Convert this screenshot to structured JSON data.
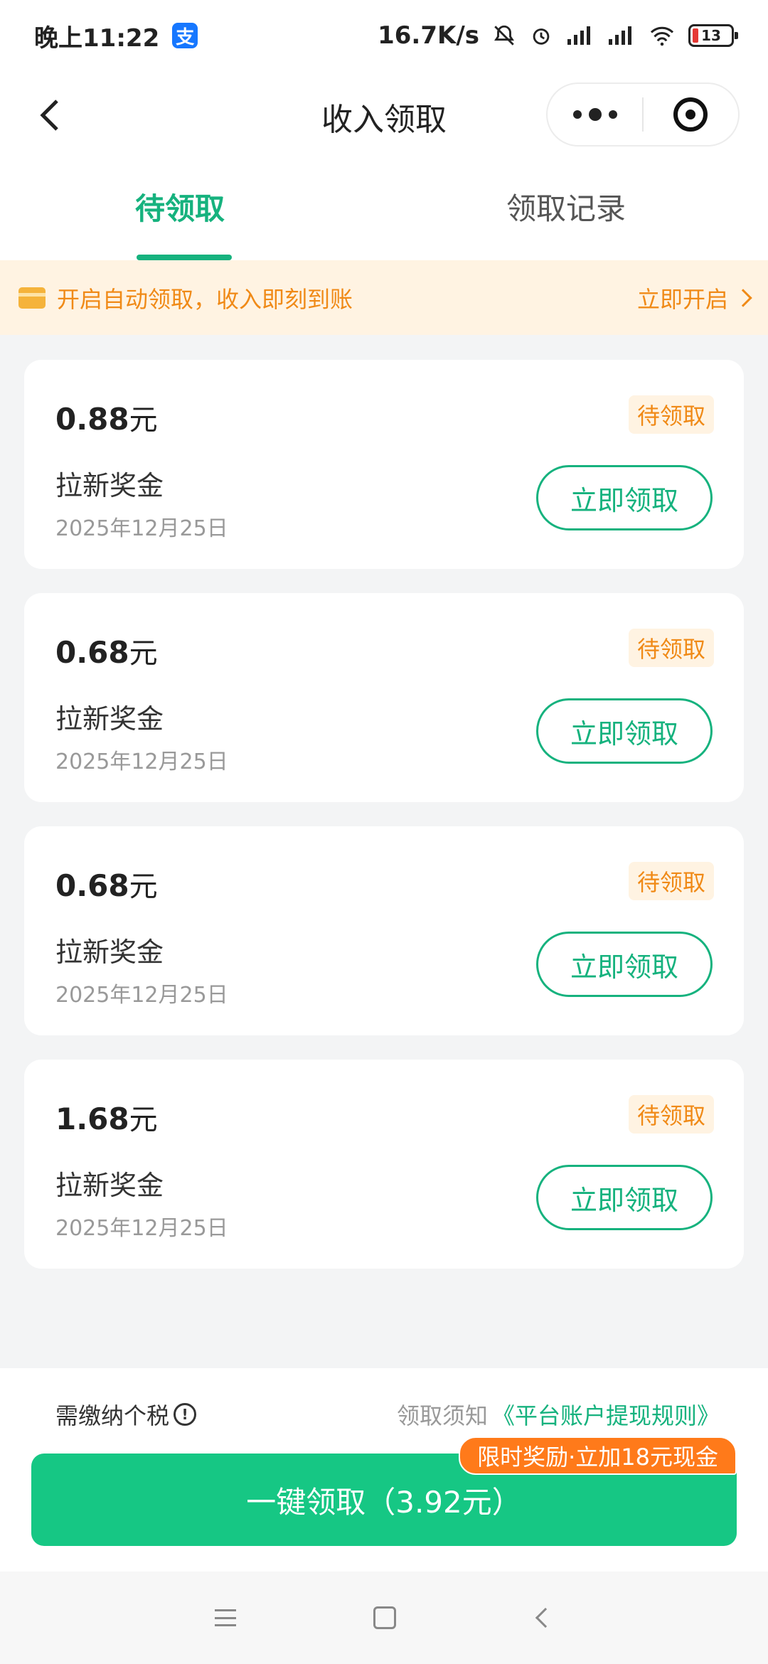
{
  "status_bar": {
    "time": "晚上11:22",
    "app_icon_glyph": "支",
    "network_speed": "16.7K/s",
    "battery": "13"
  },
  "nav": {
    "title": "收入领取"
  },
  "tabs": [
    {
      "label": "待领取",
      "active": true
    },
    {
      "label": "领取记录",
      "active": false
    }
  ],
  "banner": {
    "text": "开启自动领取，收入即刻到账",
    "action": "立即开启"
  },
  "items": [
    {
      "amount": "0.88",
      "unit": "元",
      "status": "待领取",
      "name": "拉新奖金",
      "date": "2025年12月25日",
      "button": "立即领取"
    },
    {
      "amount": "0.68",
      "unit": "元",
      "status": "待领取",
      "name": "拉新奖金",
      "date": "2025年12月25日",
      "button": "立即领取"
    },
    {
      "amount": "0.68",
      "unit": "元",
      "status": "待领取",
      "name": "拉新奖金",
      "date": "2025年12月25日",
      "button": "立即领取"
    },
    {
      "amount": "1.68",
      "unit": "元",
      "status": "待领取",
      "name": "拉新奖金",
      "date": "2025年12月25日",
      "button": "立即领取"
    }
  ],
  "footer": {
    "tax_label": "需缴纳个税",
    "info_glyph": "!",
    "notice_label": "领取须知",
    "notice_link": "《平台账户提现规则》",
    "claim_all": "一键领取（3.92元）",
    "promo": "限时奖励·立加18元现金"
  },
  "colors": {
    "accent": "#16b27e",
    "button_green": "#16c784",
    "warning_orange": "#f08a17",
    "promo_orange": "#ff7a1a"
  }
}
